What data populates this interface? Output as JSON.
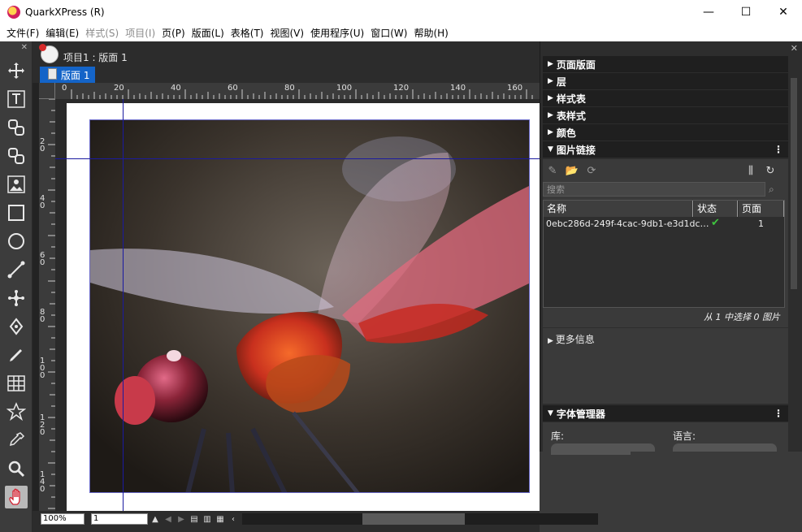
{
  "window": {
    "title": "QuarkXPress (R)",
    "minimize": "—",
    "maximize": "☐",
    "close": "✕"
  },
  "menu": [
    {
      "label": "文件(F)",
      "enabled": true
    },
    {
      "label": "编辑(E)",
      "enabled": true
    },
    {
      "label": "样式(S)",
      "enabled": false
    },
    {
      "label": "项目(I)",
      "enabled": false
    },
    {
      "label": "页(P)",
      "enabled": true
    },
    {
      "label": "版面(L)",
      "enabled": true
    },
    {
      "label": "表格(T)",
      "enabled": true
    },
    {
      "label": "视图(V)",
      "enabled": true
    },
    {
      "label": "使用程序(U)",
      "enabled": true
    },
    {
      "label": "窗口(W)",
      "enabled": true
    },
    {
      "label": "帮助(H)",
      "enabled": true
    }
  ],
  "toolbar": {
    "close": "✕",
    "tools": [
      "move-tool",
      "text-tool",
      "text-link-tool",
      "text-unlink-tool",
      "picture-content-tool",
      "rectangle-box-tool",
      "oval-box-tool",
      "line-tool",
      "pen-tool",
      "bezier-tool",
      "freehand-pen-tool",
      "table-tool",
      "star-tool",
      "eyedropper-tool",
      "zoom-tool",
      "pan-tool"
    ],
    "active": "pan-tool"
  },
  "document": {
    "project_title": "项目1 : 版面 1",
    "layout_tab": "版面 1",
    "ruler_h": [
      "0",
      "20",
      "40",
      "60",
      "80",
      "100",
      "120",
      "140",
      "160"
    ],
    "ruler_v": [
      "2\n0",
      "4\n0",
      "6\n0",
      "8\n0",
      "1\n0\n0",
      "1\n2\n0",
      "1\n4\n0"
    ],
    "zoom": "100%",
    "page": "1"
  },
  "panel": {
    "close": "✕",
    "sections": [
      "页面版面",
      "层",
      "样式表",
      "表样式",
      "颜色"
    ],
    "picture_links": {
      "title": "图片链接",
      "search_placeholder": "搜索",
      "columns": [
        "名称",
        "状态",
        "页面"
      ],
      "rows": [
        {
          "name": "0ebc286d-249f-4cac-9db1-e3d1dc…",
          "status": "✔",
          "page": "1"
        }
      ],
      "selection_status": "从 1 中选择 0 图片",
      "more_info": "更多信息"
    },
    "font_manager": {
      "title": "字体管理器",
      "library_label": "库:",
      "language_label": "语言:"
    }
  }
}
